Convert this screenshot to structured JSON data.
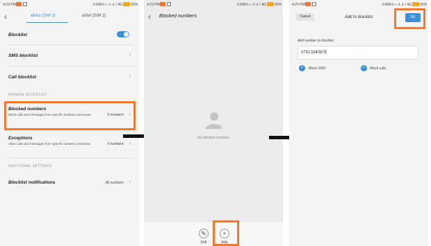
{
  "status": {
    "p1": {
      "time": "4:23 PM",
      "speed": "0.00K/s",
      "network": "4G",
      "battery": "55%"
    },
    "p2": {
      "time": "4:23 PM",
      "speed": "0.00K/s",
      "network": "4G",
      "battery": "55%"
    },
    "p3": {
      "time": "4:20 PM",
      "speed": "0.86K/s",
      "network": "4G",
      "battery": "55%"
    }
  },
  "screen1": {
    "sim_tabs": [
      "akiira (SIM 1)",
      "airtel (SIM 2)"
    ],
    "rows": {
      "blocklist": "Blocklist",
      "sms_blocklist": "SMS blocklist",
      "call_blocklist": "Call blocklist"
    },
    "section_manage": "MANAGE BLOCKLIST",
    "blocked_numbers": {
      "label": "Blocked numbers",
      "sub": "Block calls and messages from specific numbers and areas",
      "value": "0 numbers"
    },
    "exceptions": {
      "label": "Exceptions",
      "sub": "Allow calls and messages from specific numbers and areas",
      "value": "0 numbers"
    },
    "section_additional": "ADDITIONAL SETTINGS",
    "notifications": {
      "label": "Blocklist notifications",
      "value": "All numbers"
    }
  },
  "screen2": {
    "title": "Blocked numbers",
    "empty": "No blocked numbers",
    "edit_label": "Edit",
    "add_label": "Add"
  },
  "screen3": {
    "cancel": "Cancel",
    "title": "Add to blacklist",
    "ok": "OK",
    "field_label": "Add number to blocklist",
    "field_value": "07913340678",
    "block_sms": "Block SMS",
    "block_calls": "Block calls"
  },
  "colors": {
    "accent": "#3a8fd9",
    "highlight": "#ee7b34"
  },
  "icons": [
    "back-icon",
    "chevron-right-icon",
    "person-icon",
    "edit-icon",
    "plus-icon",
    "check-icon"
  ]
}
